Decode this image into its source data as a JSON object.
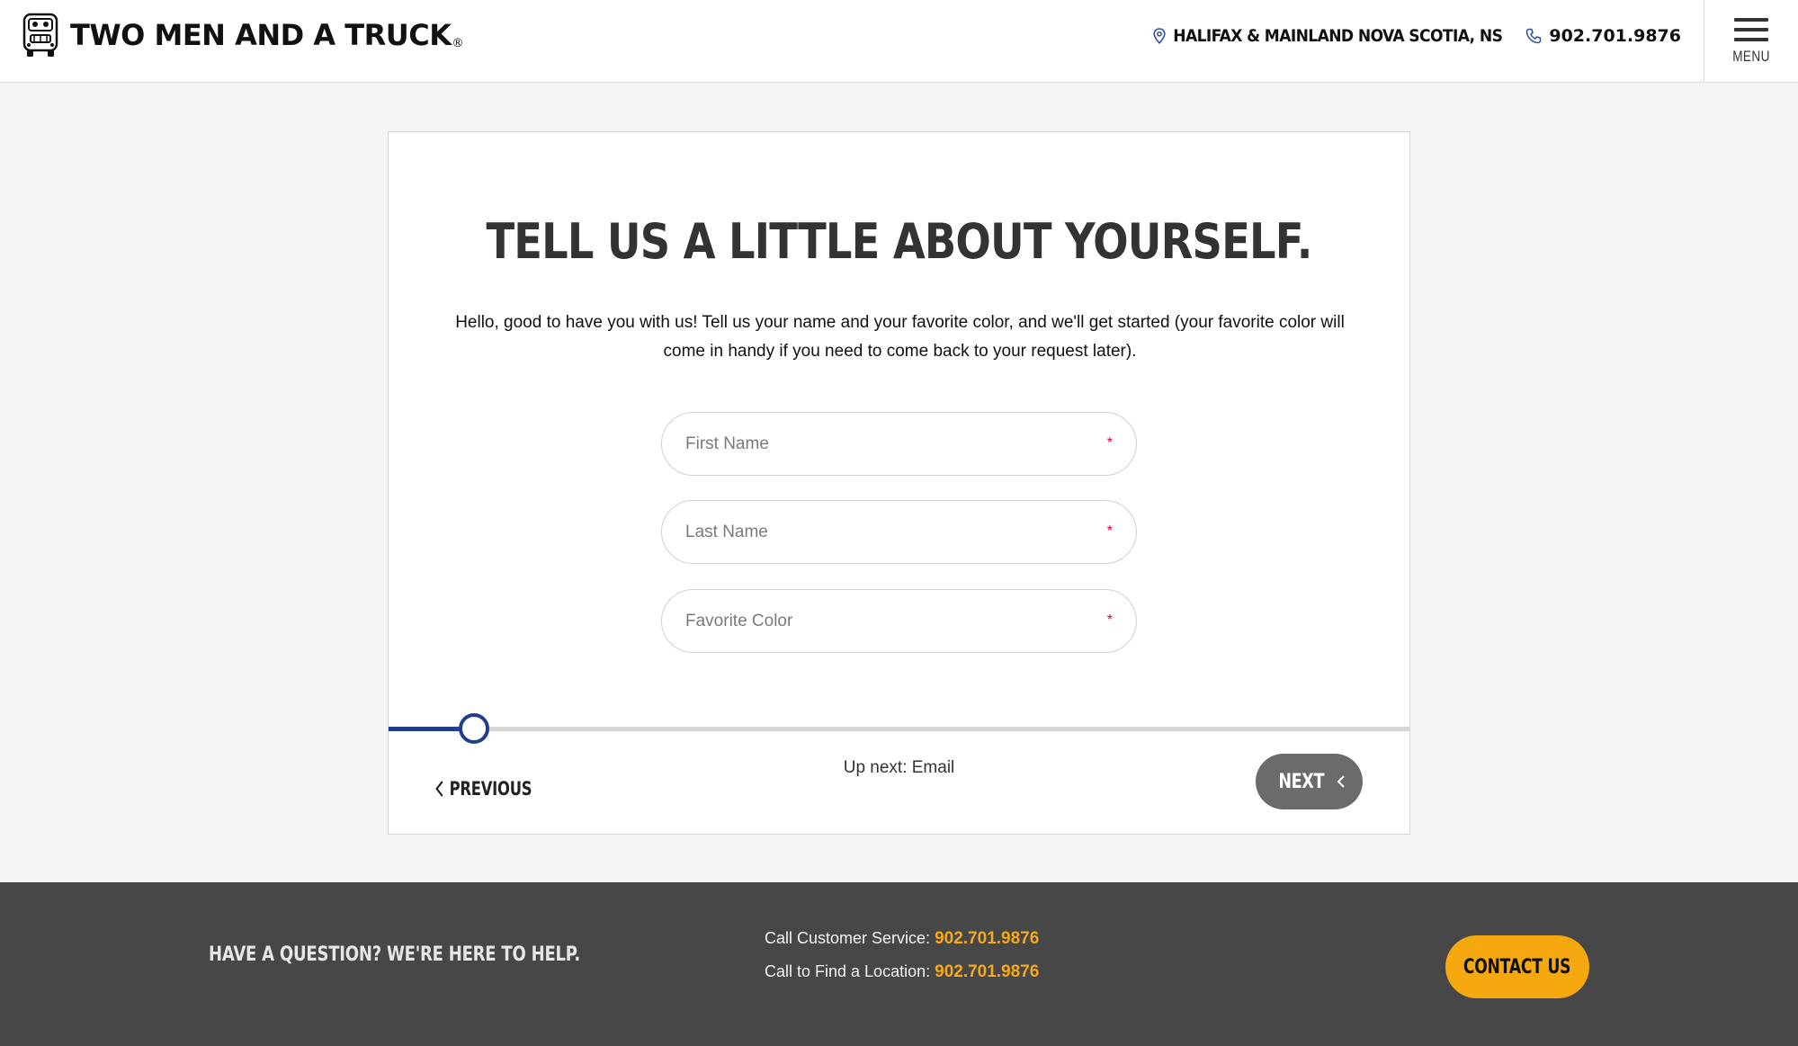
{
  "header": {
    "brand_name": "TWO MEN AND A TRUCK",
    "brand_registered": "®",
    "location_label": "HALIFAX & MAINLAND NOVA SCOTIA, NS",
    "phone": "902.701.9876",
    "menu_label": "MENU",
    "icons": [
      "truck-logo-icon",
      "map-pin-icon",
      "phone-icon",
      "hamburger-menu-icon"
    ]
  },
  "form": {
    "title": "TELL US A LITTLE ABOUT YOURSELF.",
    "intro": "Hello, good to have you with us! Tell us your name and your favorite color, and we'll get started (your favorite color will come in handy if you need to come back to your request later).",
    "fields": [
      {
        "placeholder": "First Name",
        "value": "",
        "required_mark": "*"
      },
      {
        "placeholder": "Last Name",
        "value": "",
        "required_mark": "*"
      },
      {
        "placeholder": "Favorite Color",
        "value": "",
        "required_mark": "*"
      }
    ],
    "progress_fraction": 0.084,
    "previous_label": "PREVIOUS",
    "up_next": "Up next: Email",
    "next_label": "NEXT"
  },
  "footer": {
    "question": "HAVE A QUESTION? WE'RE HERE TO HELP.",
    "customer_service_label": "Call Customer Service:",
    "customer_service_phone": "902.701.9876",
    "find_location_label": "Call to Find a Location:",
    "find_location_phone": "902.701.9876",
    "contact_label": "CONTACT US"
  },
  "colors": {
    "accent_blue": "#1f3f8c",
    "accent_yellow": "#f5a80f",
    "footer_bg": "#474747",
    "required_red": "#e0003a"
  }
}
